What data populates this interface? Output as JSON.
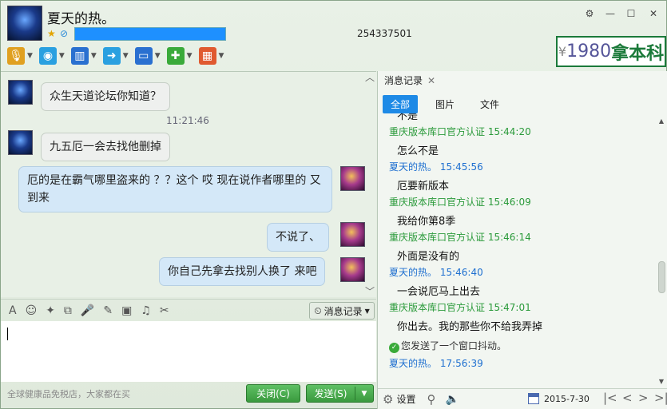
{
  "window": {
    "title": "夏天的热。",
    "number": "254337501",
    "controls": [
      "⚙",
      "—",
      "☐",
      "✕"
    ]
  },
  "ad": {
    "text": "1980",
    "brand": "拿本科",
    "prefix": "¥"
  },
  "toolbar": [
    {
      "name": "mic-icon",
      "glyph": "🎙",
      "color": "#e0a020"
    },
    {
      "name": "camera-icon",
      "glyph": "◉",
      "color": "#2aa0e0"
    },
    {
      "name": "screen-share-icon",
      "glyph": "▥",
      "color": "#2a70d0"
    },
    {
      "name": "file-transfer-icon",
      "glyph": "➜",
      "color": "#2aa0e0"
    },
    {
      "name": "remote-desktop-icon",
      "glyph": "▭",
      "color": "#2a70d0"
    },
    {
      "name": "add-app-icon",
      "glyph": "✚",
      "color": "#3aaa3a"
    },
    {
      "name": "apps-icon",
      "glyph": "▦",
      "color": "#e05a30"
    }
  ],
  "chat": {
    "messages": [
      {
        "side": "l",
        "text": "众生天道论坛你知道？"
      },
      {
        "side": "l",
        "text": "九五厄一会去找他删掉"
      },
      {
        "side": "r",
        "text": "厄的是在霸气哪里盗来的 ？？这个 哎 现在说作者哪里的 又到来"
      },
      {
        "side": "r",
        "text": "不说了、"
      },
      {
        "side": "r",
        "text": "你自己先拿去找别人换了 来吧"
      }
    ],
    "time": "11:21:46"
  },
  "input_toolbar": {
    "icons": [
      "font-icon",
      "emoji-icon",
      "magic-icon",
      "gif-icon",
      "voice-icon",
      "edit-icon",
      "image-icon",
      "music-icon",
      "screenshot-icon"
    ],
    "glyphs": [
      "A",
      "☺",
      "✦",
      "⧉",
      "🎤",
      "✎",
      "▣",
      "♫",
      "✂"
    ],
    "history_button": "消息记录"
  },
  "footer": {
    "ad_text": "全球健康品免税店，大家都在买",
    "close": "关闭(C)",
    "send": "发送(S)"
  },
  "history": {
    "tab": "消息记录",
    "filters": [
      "全部",
      "图片",
      "文件"
    ],
    "items": [
      {
        "type": "msg",
        "text": "不是"
      },
      {
        "type": "sender",
        "who": "g",
        "text": "重庆版本库口官方认证 15:44:20"
      },
      {
        "type": "msg",
        "text": "怎么不是"
      },
      {
        "type": "sender",
        "who": "b",
        "text": "夏天的热。 15:45:56"
      },
      {
        "type": "msg",
        "text": "厄要新版本"
      },
      {
        "type": "sender",
        "who": "g",
        "text": "重庆版本库口官方认证 15:46:09"
      },
      {
        "type": "msg",
        "text": "我给你第8季"
      },
      {
        "type": "sender",
        "who": "g",
        "text": "重庆版本库口官方认证 15:46:14"
      },
      {
        "type": "msg",
        "text": "外面是没有的"
      },
      {
        "type": "sender",
        "who": "b",
        "text": "夏天的热。 15:46:40"
      },
      {
        "type": "msg",
        "text": "一会说厄马上出去"
      },
      {
        "type": "sender",
        "who": "g",
        "text": "重庆版本库口官方认证 15:47:01"
      },
      {
        "type": "msg",
        "text": "你出去。我的那些你不给我弄掉"
      },
      {
        "type": "notice",
        "text": "您发送了一个窗口抖动。"
      },
      {
        "type": "sender",
        "who": "b",
        "text": "夏天的热。 17:56:39"
      }
    ],
    "settings": "设置",
    "date": "2015-7-30"
  }
}
